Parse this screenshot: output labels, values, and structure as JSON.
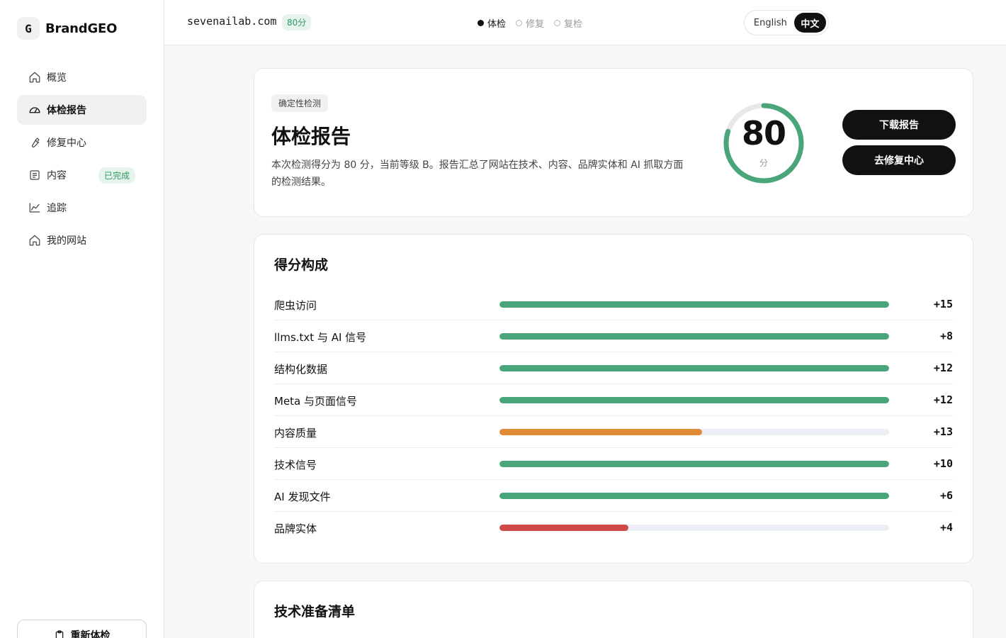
{
  "sidebar": {
    "brand_letter": "G",
    "brand_name": "BrandGEO",
    "items": [
      {
        "label": "概览",
        "icon": "home-icon"
      },
      {
        "label": "体检报告",
        "icon": "gauge-icon"
      },
      {
        "label": "修复中心",
        "icon": "wrench-icon"
      },
      {
        "label": "内容",
        "icon": "document-list-icon",
        "badge": "已完成"
      },
      {
        "label": "追踪",
        "icon": "line-chart-icon"
      },
      {
        "label": "我的网站",
        "icon": "home-icon"
      }
    ],
    "active_item": "体检报告",
    "recheck_label": "重新体检"
  },
  "topbar": {
    "domain": "sevenailab.com",
    "score_pill": "80分",
    "steps": [
      "体检",
      "修复",
      "复检"
    ],
    "active_step": "体检",
    "lang_en": "English",
    "lang_zh": "中文",
    "active_lang": "中文"
  },
  "hero": {
    "tag": "确定性检测",
    "title": "体检报告",
    "description": "本次检测得分为 80 分，当前等级 B。报告汇总了网站在技术、内容、品牌实体和 AI 抓取方面的检测结果。",
    "score": "80",
    "score_unit": "分",
    "score_fraction": 0.8,
    "download_label": "下载报告",
    "fix_center_label": "去修复中心"
  },
  "breakdown": {
    "title": "得分构成",
    "colors": {
      "good": "#4aa67a",
      "warn": "#e08a35",
      "bad": "#d04a4a"
    },
    "rows": [
      {
        "label": "爬虫访问",
        "points": "+15",
        "fill": 1.0,
        "status": "good"
      },
      {
        "label": "llms.txt 与 AI 信号",
        "points": "+8",
        "fill": 1.0,
        "status": "good"
      },
      {
        "label": "结构化数据",
        "points": "+12",
        "fill": 1.0,
        "status": "good"
      },
      {
        "label": "Meta 与页面信号",
        "points": "+12",
        "fill": 1.0,
        "status": "good"
      },
      {
        "label": "内容质量",
        "points": "+13",
        "fill": 0.52,
        "status": "warn"
      },
      {
        "label": "技术信号",
        "points": "+10",
        "fill": 1.0,
        "status": "good"
      },
      {
        "label": "AI 发现文件",
        "points": "+6",
        "fill": 1.0,
        "status": "good"
      },
      {
        "label": "品牌实体",
        "points": "+4",
        "fill": 0.33,
        "status": "bad"
      }
    ]
  },
  "checklist": {
    "title": "技术准备清单"
  }
}
